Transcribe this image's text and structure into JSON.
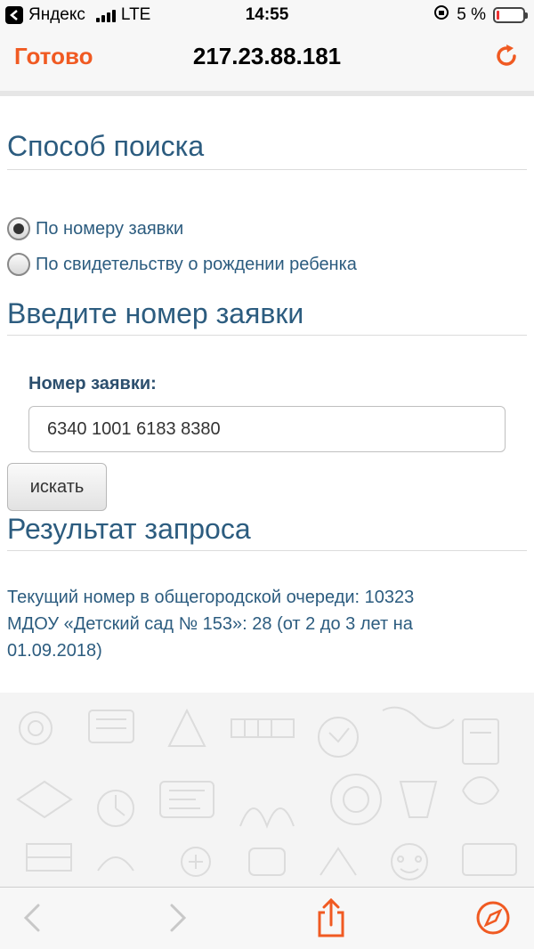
{
  "status_bar": {
    "carrier": "Яндекс",
    "network": "LTE",
    "time": "14:55",
    "battery_percent": "5 %",
    "battery_level": 0.05
  },
  "nav": {
    "done_label": "Готово",
    "title": "217.23.88.181"
  },
  "search_method": {
    "title": "Способ поиска",
    "options": [
      {
        "label": "По номеру заявки",
        "checked": true
      },
      {
        "label": "По свидетельству о рождении ребенка",
        "checked": false
      }
    ]
  },
  "request_number": {
    "title": "Введите номер заявки",
    "field_label": "Номер заявки:",
    "field_value": "6340 1001 6183 8380",
    "button_label": "искать"
  },
  "result": {
    "title": "Результат запроса",
    "lines": [
      "Текущий номер в общегородской очереди: 10323",
      "МДОУ «Детский сад № 153»: 28 (от 2 до 3 лет на",
      "01.09.2018)"
    ]
  },
  "colors": {
    "accent": "#f05a22",
    "heading": "#2c5c7f"
  }
}
